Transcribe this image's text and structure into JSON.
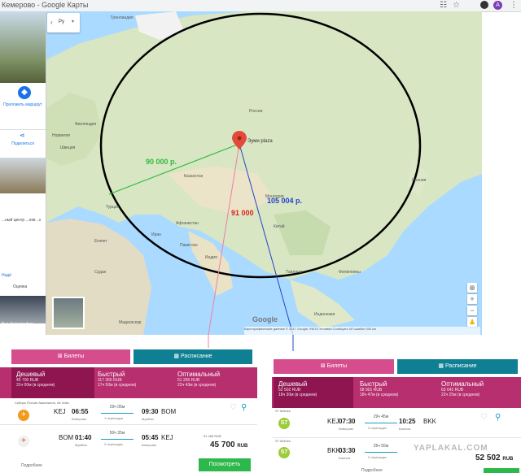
{
  "browser": {
    "title": "Кемерово - Google Карты",
    "avatar_letter": "A"
  },
  "search": {
    "text": "Ру"
  },
  "left_panel": {
    "route_label": "Проложить маршрут",
    "share_label": "Поделиться",
    "place_text": "...ный центр ...нки ..з",
    "rating_link": "Надё",
    "rating_label": "Оценка",
    "photos_label": "Все фотографии"
  },
  "map": {
    "marker_label": "Эуми plaza",
    "prices": {
      "green": "90 000 р.",
      "red": "91 000",
      "blue": "105 004 р."
    },
    "labels": [
      {
        "text": "Гренландия",
        "id": "greenland"
      },
      {
        "text": "Финляндия",
        "id": "finland"
      },
      {
        "text": "Норвегия",
        "id": "norway"
      },
      {
        "text": "Швеция",
        "id": "sweden"
      },
      {
        "text": "Россия",
        "id": "russia"
      },
      {
        "text": "Казахстан",
        "id": "kazakhstan"
      },
      {
        "text": "Монголия",
        "id": "mongolia"
      },
      {
        "text": "Китай",
        "id": "china"
      },
      {
        "text": "Афганистан",
        "id": "afghanistan"
      },
      {
        "text": "Иран",
        "id": "iran"
      },
      {
        "text": "Индия",
        "id": "india"
      },
      {
        "text": "Пакистан",
        "id": "pakistan"
      },
      {
        "text": "Турция",
        "id": "turkey"
      },
      {
        "text": "Египет",
        "id": "egypt"
      },
      {
        "text": "Судан",
        "id": "sudan"
      },
      {
        "text": "Япония",
        "id": "japan"
      },
      {
        "text": "Таиланд",
        "id": "thailand"
      },
      {
        "text": "Филиппины",
        "id": "philippines"
      },
      {
        "text": "Индонезия",
        "id": "indonesia"
      },
      {
        "text": "Мадагаскар",
        "id": "madagascar"
      }
    ],
    "google": "Google",
    "attribution": "Картографические данные © 2017 Google, INEGI   Условия   Сообщить об ошибке   500 км"
  },
  "left_booking": {
    "tabs": [
      "Билеты",
      "Расписание"
    ],
    "sorts": [
      {
        "title": "Дешевый",
        "line1": "45 700 RUB",
        "line2": "31ч 00м (в среднем)"
      },
      {
        "title": "Быстрый",
        "line1": "117 265 RUB",
        "line2": "17ч 50м (в среднем)"
      },
      {
        "title": "Оптимальный",
        "line1": "51 265 RUB",
        "line2": "22ч 43м (в среднем)"
      }
    ],
    "flights": [
      {
        "airline": "Сибирь Россия Авиалиния, Air India",
        "dep_time": "06:55",
        "dep_code": "KEJ",
        "dep_city": "Кемерово",
        "dur": "29ч 05м",
        "stops": "1 пересадка",
        "arr_time": "09:30",
        "arr_code": "BOM",
        "arr_city": "Мумбаи"
      },
      {
        "airline": "",
        "dep_time": "01:40",
        "dep_code": "BOM",
        "dep_city": "Мумбаи",
        "dur": "50ч 35м",
        "stops": "2 пересадки",
        "arr_time": "05:45",
        "arr_code": "KEJ",
        "arr_city": "Кемерово"
      }
    ],
    "old_price": "51 465 RUB",
    "price": "45 700",
    "currency": "RUB",
    "more_label": "Подробнее",
    "buy_button": "Посмотреть"
  },
  "right_booking": {
    "tabs": [
      "Билеты",
      "Расписание"
    ],
    "sorts": [
      {
        "title": "Дешевый",
        "line1": "52 502 RUB",
        "line2": "18ч 30м (в среднем)"
      },
      {
        "title": "Быстрый",
        "line1": "58 901 RUB",
        "line2": "18ч 47м (в среднем)"
      },
      {
        "title": "Оптимальный",
        "line1": "63 642 RUB",
        "line2": "22ч 25м (в среднем)"
      }
    ],
    "flights": [
      {
        "airline": "S7 Airlines",
        "dep_time": "07:30",
        "dep_code": "KEJ",
        "dep_city": "Кемерово",
        "dur": "29ч 45м",
        "stops": "2 пересадки",
        "arr_time": "10:25",
        "arr_code": "BKK",
        "arr_city": "Бангкок"
      },
      {
        "airline": "S7 Airlines",
        "dep_time": "03:30",
        "dep_code": "BKK",
        "dep_city": "Бангкок",
        "dur": "26ч 55м",
        "stops": "2 пересадки",
        "arr_time": "",
        "arr_code": "",
        "arr_city": ""
      }
    ],
    "price": "52 502",
    "currency": "RUB",
    "footer": "Подробнее"
  },
  "watermark": "YAPLAKAL.COM"
}
